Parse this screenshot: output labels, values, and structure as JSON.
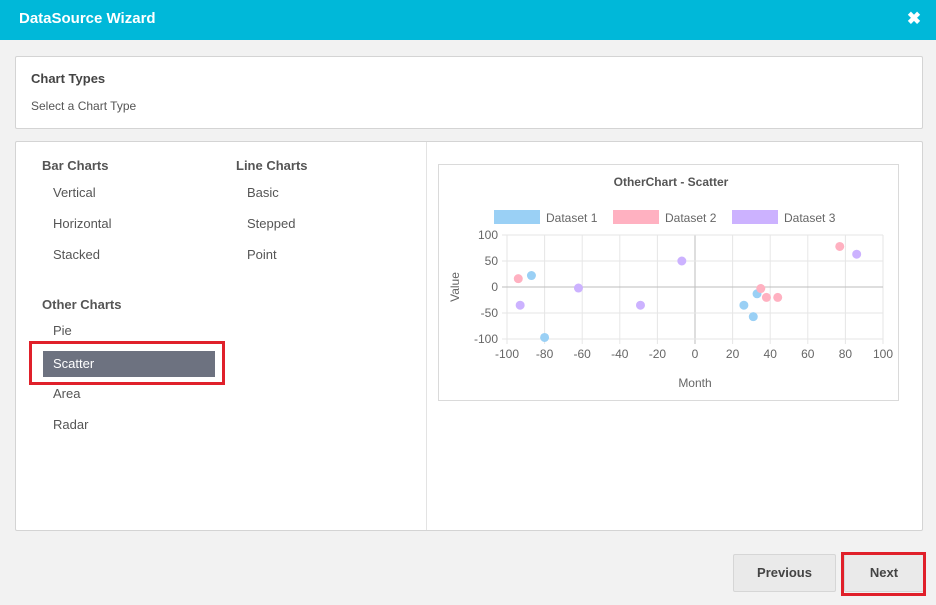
{
  "window": {
    "title": "DataSource Wizard",
    "close_icon": "close-icon"
  },
  "chart_types": {
    "heading": "Chart Types",
    "subheading": "Select a Chart Type"
  },
  "groups": {
    "bar": {
      "title": "Bar Charts",
      "items": [
        "Vertical",
        "Horizontal",
        "Stacked"
      ]
    },
    "line": {
      "title": "Line Charts",
      "items": [
        "Basic",
        "Stepped",
        "Point"
      ]
    },
    "other": {
      "title": "Other Charts",
      "items": [
        "Pie",
        "Scatter",
        "Area",
        "Radar"
      ]
    }
  },
  "selected_type": "Scatter",
  "highlight_color": "#e0202a",
  "accent_color": "#00b8d9",
  "chart_data": {
    "type": "scatter",
    "title": "OtherChart - Scatter",
    "xlabel": "Month",
    "ylabel": "Value",
    "xlim": [
      -100,
      100
    ],
    "ylim": [
      -100,
      100
    ],
    "xticks": [
      -100,
      -80,
      -60,
      -40,
      -20,
      0,
      20,
      40,
      60,
      80,
      100
    ],
    "yticks": [
      100,
      50,
      0,
      -50,
      -100
    ],
    "grid": true,
    "legend": "top",
    "series": [
      {
        "name": "Dataset 1",
        "color": "#9ad0f5",
        "dot": "#36a2eb",
        "points": [
          [
            -87,
            22
          ],
          [
            -80,
            -97
          ],
          [
            26,
            -35
          ],
          [
            31,
            -57
          ],
          [
            33,
            -13
          ]
        ]
      },
      {
        "name": "Dataset 2",
        "color": "#ffb1c1",
        "dot": "#ff6384",
        "points": [
          [
            -94,
            16
          ],
          [
            35,
            -3
          ],
          [
            38,
            -20
          ],
          [
            44,
            -20
          ],
          [
            77,
            78
          ]
        ]
      },
      {
        "name": "Dataset 3",
        "color": "#ccb2ff",
        "dot": "#9966ff",
        "points": [
          [
            -93,
            -35
          ],
          [
            -62,
            -2
          ],
          [
            -29,
            -35
          ],
          [
            -7,
            50
          ],
          [
            86,
            63
          ]
        ]
      }
    ]
  },
  "buttons": {
    "previous": "Previous",
    "next": "Next"
  }
}
